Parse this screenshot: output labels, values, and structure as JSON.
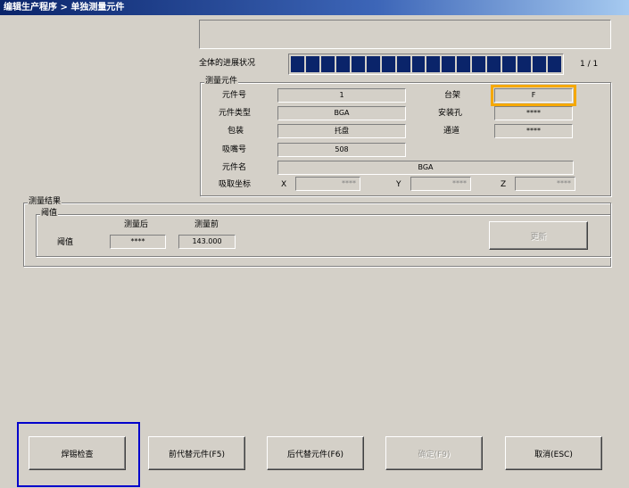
{
  "title": "编辑生产程序 > 单独测量元件",
  "progress": {
    "label": "全体的进展状况",
    "counter": "1 / 1",
    "fraction": 1.0,
    "segments": 18
  },
  "measure_part": {
    "group_title": "测量元件",
    "part_no_label": "元件号",
    "part_no_value": "1",
    "rack_label": "台架",
    "rack_value": "F",
    "part_type_label": "元件类型",
    "part_type_value": "BGA",
    "install_hole_label": "安装孔",
    "install_hole_value": "****",
    "package_label": "包装",
    "package_value": "托盘",
    "channel_label": "通道",
    "channel_value": "****",
    "nozzle_label": "吸嘴号",
    "nozzle_value": "508",
    "part_name_label": "元件名",
    "part_name_value": "BGA",
    "pick_coord_label": "吸取坐标",
    "x_label": "X",
    "x_value": "****",
    "y_label": "Y",
    "y_value": "****",
    "z_label": "Z",
    "z_value": "****"
  },
  "result": {
    "group_title": "测量结果",
    "threshold_group_title": "阈值",
    "after_label": "测量后",
    "before_label": "测量前",
    "row_label": "阈值",
    "after_value": "****",
    "before_value": "143.000",
    "update_label": "更新"
  },
  "buttons": {
    "solder_check": "焊锡检查",
    "prev_alt": "前代替元件(F5)",
    "next_alt": "后代替元件(F6)",
    "confirm": "确定(F9)",
    "cancel": "取消(ESC)"
  },
  "colors": {
    "progress_fill": "#0a246a",
    "highlight_rack": "#f5a800",
    "highlight_solder": "#0000cc"
  }
}
